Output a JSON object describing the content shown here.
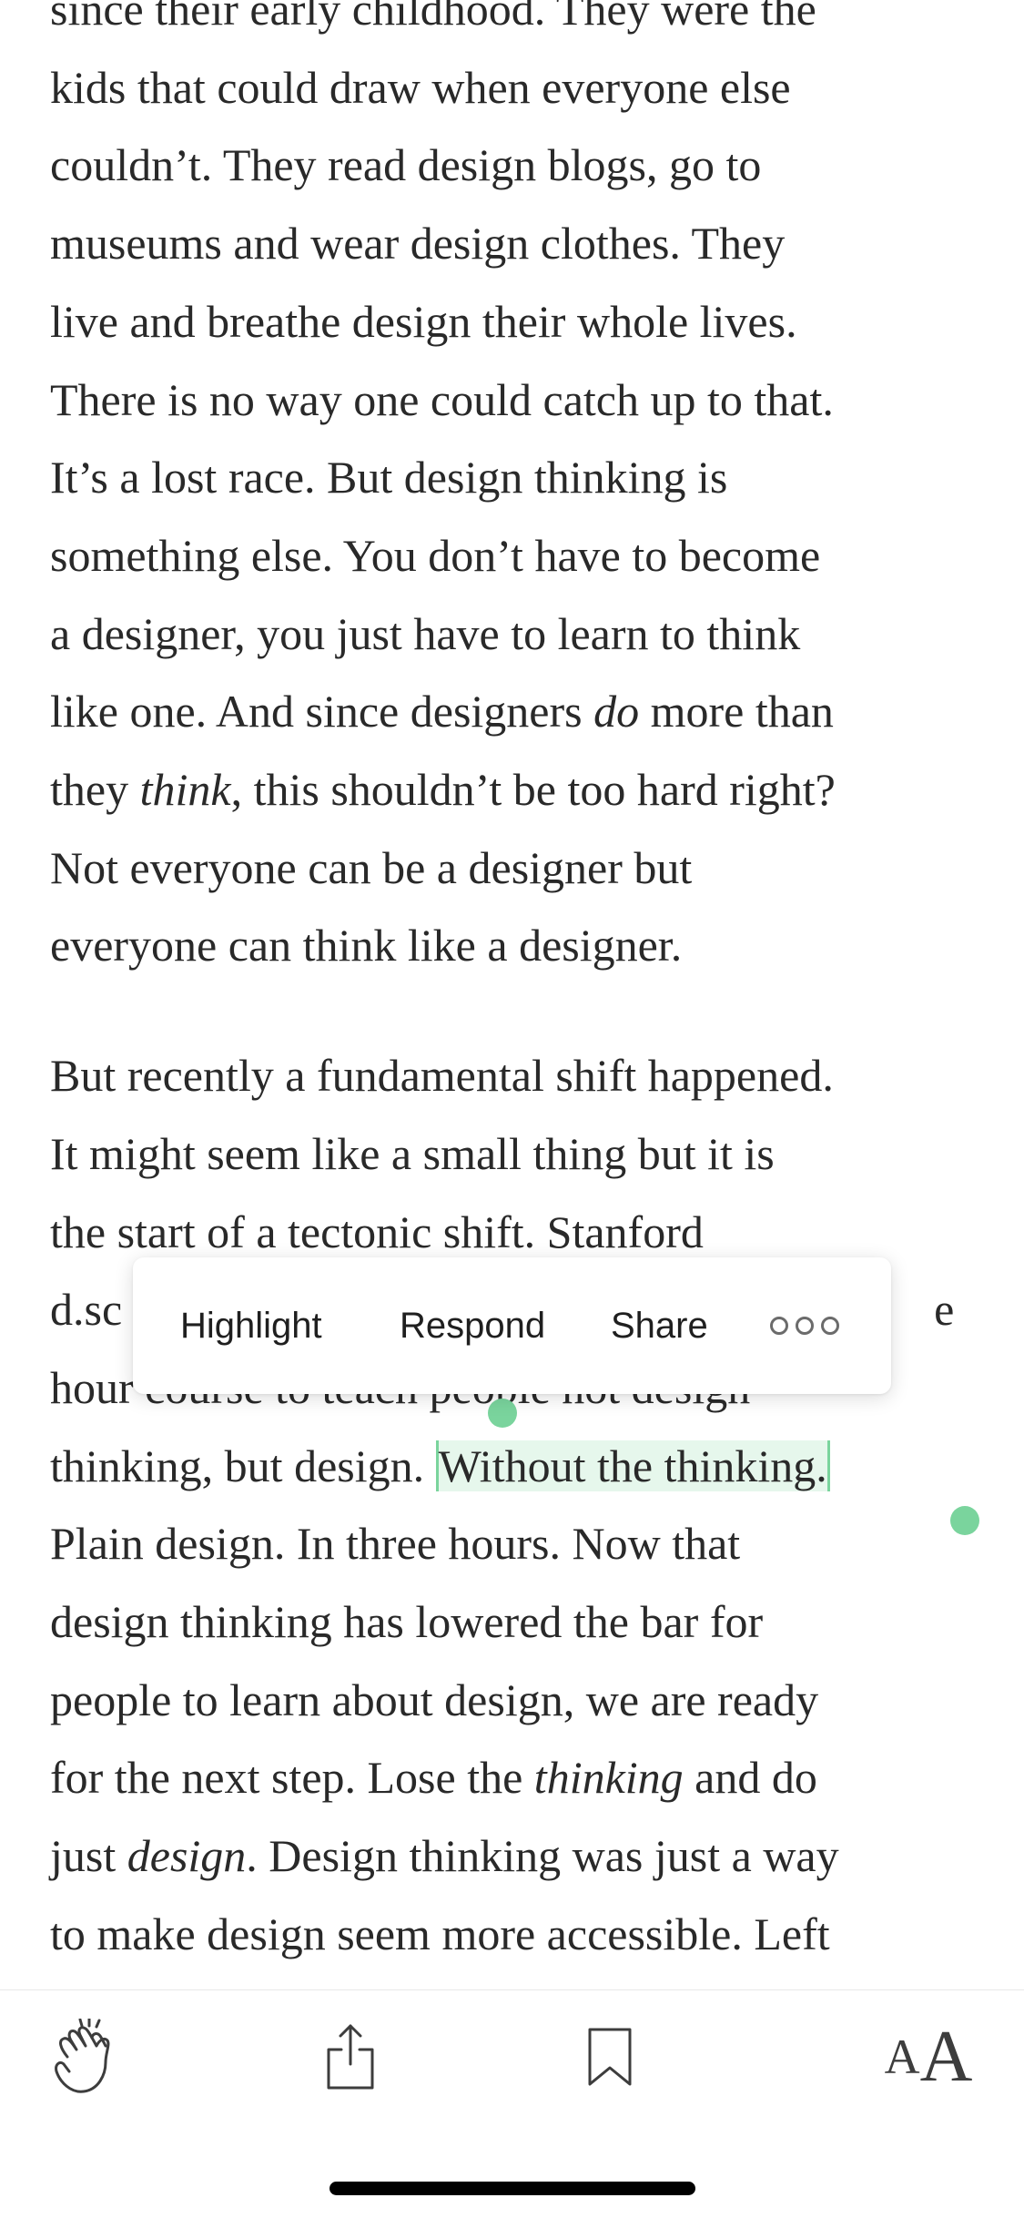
{
  "article": {
    "paragraph1": {
      "lines": [
        "since their early childhood. They were the",
        "kids that could draw when everyone else",
        "couldn’t. They read design blogs, go to",
        "museums and wear design clothes. They",
        "live and breathe design their whole lives.",
        "There is no way one could catch up to that.",
        "It’s a lost race. But design thinking is",
        "something else. You don’t have to become",
        "a designer, you just have to learn to think",
        "like one. And since designers ",
        "do",
        " more than",
        "they ",
        "think",
        ", this shouldn’t be too hard right?",
        "Not everyone can be a designer but",
        "everyone can think like a designer."
      ]
    },
    "paragraph2": {
      "line1": "But recently a fundamental shift happened.",
      "line2": "It might seem like a small thing but it is",
      "line3": "the start of a tectonic shift. Stanford",
      "line4_prefix": "d.sc",
      "line4_suffix": "e",
      "line5": "hour course to teach people not design",
      "line6_before": "thinking, but design. ",
      "line6_selected": "Without the thinking.",
      "line7": "Plain design. In three hours. Now that",
      "line8": "design thinking has lowered the bar for",
      "line9": "people to learn about design, we are ready",
      "line10_a": "for the next step. Lose the ",
      "line10_em": "thinking",
      "line10_b": " and do",
      "line11_a": "just ",
      "line11_em": "design",
      "line11_b": ". Design thinking was just a way",
      "line12": "to make design seem more accessible. Left"
    }
  },
  "selection_menu": {
    "highlight": "Highlight",
    "respond": "Respond",
    "share": "Share",
    "more_icon": "more-horizontal-icon"
  },
  "toolbar": {
    "clap_icon": "clap-icon",
    "share_icon": "share-icon",
    "bookmark_icon": "bookmark-icon",
    "font_small": "A",
    "font_large": "A"
  },
  "colors": {
    "selection_bg": "#e6f7ec",
    "selection_handle": "#7ad49d",
    "text": "#292929"
  }
}
